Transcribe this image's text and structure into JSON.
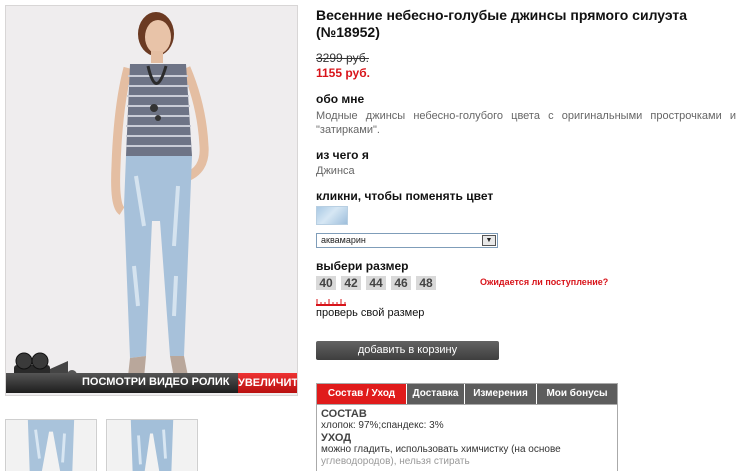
{
  "product": {
    "title": "Весенние небесно-голубые джинсы прямого силуэта (№18952)",
    "old_price": "3299 руб.",
    "new_price": "1155 руб."
  },
  "about": {
    "heading": "обо мне",
    "text": "Модные джинсы небесно-голубого цвета с оригинальными прострочками и \"затирками\"."
  },
  "material": {
    "heading": "из чего я",
    "text": "Джинса"
  },
  "color": {
    "heading": "кликни, чтобы поменять цвет",
    "selected": "аквамарин",
    "swatch_color": "#bcd6ec"
  },
  "size": {
    "heading": "выбери размер",
    "options": [
      "40",
      "42",
      "44",
      "46",
      "48"
    ],
    "awaiting_link": "Ожидается ли поступление?",
    "check_link": "проверь свой размер"
  },
  "cart": {
    "button": "добавить в корзину"
  },
  "photo": {
    "video_label": "ПОСМОТРИ ВИДЕО РОЛИК",
    "enlarge": "УВЕЛИЧИТЬ"
  },
  "tabs": {
    "items": [
      {
        "label": "Состав / Уход",
        "active": true
      },
      {
        "label": "Доставка",
        "active": false
      },
      {
        "label": "Измерения",
        "active": false
      },
      {
        "label": "Мои бонусы",
        "active": false
      }
    ],
    "content": {
      "composition_heading": "СОСТАВ",
      "composition_text": "хлопок: 97%;спандекс: 3%",
      "care_heading": "УХОД",
      "care_text": "можно гладить, использовать химчистку (на основе",
      "care_text_2": "углеводородов), нельзя стирать"
    }
  },
  "colors": {
    "accent_red": "#e01b1b",
    "price_red": "#d8141a",
    "button_gray": "#4f4f4f"
  }
}
